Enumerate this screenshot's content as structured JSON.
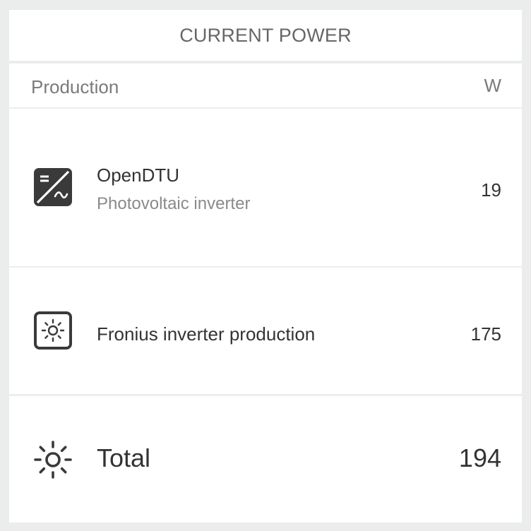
{
  "card": {
    "title": "CURRENT POWER"
  },
  "table": {
    "section_label": "Production",
    "unit_label": "W"
  },
  "devices": [
    {
      "name": "OpenDTU",
      "subtitle": "Photovoltaic inverter",
      "value": "19",
      "icon": "solar-inverter-icon"
    },
    {
      "name": "Fronius inverter production",
      "value": "175",
      "icon": "solar-panel-sun-icon"
    }
  ],
  "total": {
    "label": "Total",
    "value": "194",
    "icon": "sun-icon"
  },
  "colors": {
    "background": "#ebecec",
    "card": "#ffffff",
    "text_primary": "#333333",
    "text_secondary": "#7a7a7a",
    "icon": "#3a3a3a",
    "divider": "#ececec"
  }
}
